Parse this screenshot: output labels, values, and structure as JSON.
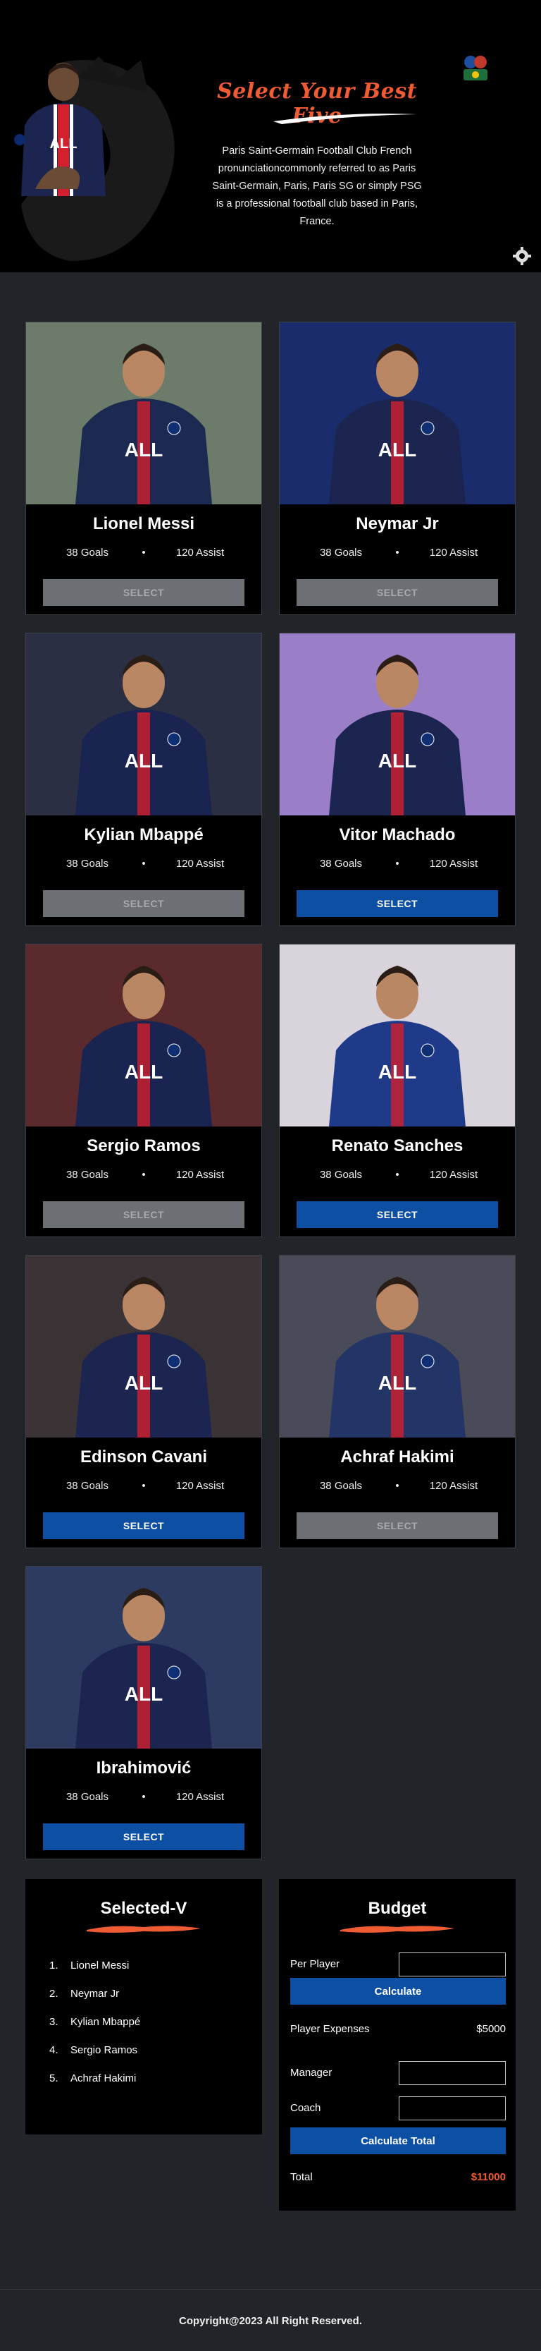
{
  "header": {
    "title": "Select Your Best Five",
    "description": "Paris Saint-Germain Football Club French pronunciationcommonly referred to as Paris Saint-Germain, Paris, Paris SG or simply PSG is a professional football club based in Paris, France."
  },
  "players": [
    {
      "name": "Lionel Messi",
      "goals": "38 Goals",
      "assists": "120 Assist",
      "button": "SELECT",
      "state": "disabled",
      "jersey": "#1c2a52",
      "bg": "#6d7b6a"
    },
    {
      "name": "Neymar Jr",
      "goals": "38 Goals",
      "assists": "120 Assist",
      "button": "SELECT",
      "state": "disabled",
      "jersey": "#1b2550",
      "bg": "#1a2c6b"
    },
    {
      "name": "Kylian Mbappé",
      "goals": "38 Goals",
      "assists": "120 Assist",
      "button": "SELECT",
      "state": "disabled",
      "jersey": "#1a2450",
      "bg": "#2b2f44"
    },
    {
      "name": "Vitor Machado",
      "goals": "38 Goals",
      "assists": "120 Assist",
      "button": "SELECT",
      "state": "active",
      "jersey": "#1b2550",
      "bg": "#9b7ec8"
    },
    {
      "name": "Sergio Ramos",
      "goals": "38 Goals",
      "assists": "120 Assist",
      "button": "SELECT",
      "state": "disabled",
      "jersey": "#1a2450",
      "bg": "#5a2a2c"
    },
    {
      "name": "Renato Sanches",
      "goals": "38 Goals",
      "assists": "120 Assist",
      "button": "SELECT",
      "state": "active",
      "jersey": "#203a8a",
      "bg": "#d9d4dc"
    },
    {
      "name": "Edinson Cavani",
      "goals": "38 Goals",
      "assists": "120 Assist",
      "button": "SELECT",
      "state": "active",
      "jersey": "#1b2550",
      "bg": "#3b3336"
    },
    {
      "name": "Achraf Hakimi",
      "goals": "38 Goals",
      "assists": "120 Assist",
      "button": "SELECT",
      "state": "disabled",
      "jersey": "#233566",
      "bg": "#4a4b58"
    },
    {
      "name": "Ibrahimović",
      "goals": "38 Goals",
      "assists": "120 Assist",
      "button": "SELECT",
      "state": "active",
      "jersey": "#1c2550",
      "bg": "#2e3b60"
    }
  ],
  "selected": {
    "title": "Selected-V",
    "items": [
      "Lionel Messi",
      "Neymar Jr",
      "Kylian Mbappé",
      "Sergio Ramos",
      "Achraf Hakimi"
    ],
    "numbers": [
      "1.",
      "2.",
      "3.",
      "4.",
      "5."
    ]
  },
  "budget": {
    "title": "Budget",
    "per_player_label": "Per Player",
    "per_player_value": "",
    "calculate_label": "Calculate",
    "expenses_label": "Player Expenses",
    "expenses_value": "$5000",
    "manager_label": "Manager",
    "manager_value": "",
    "coach_label": "Coach",
    "coach_value": "",
    "calculate_total_label": "Calculate Total",
    "total_label": "Total",
    "total_value": "$11000"
  },
  "footer": {
    "text": "Copyright@2023 All Right Reserved."
  },
  "colors": {
    "accent": "#ef5b32",
    "button_active": "#0d4fa3",
    "button_disabled": "#6c6f73",
    "background": "#212428"
  }
}
